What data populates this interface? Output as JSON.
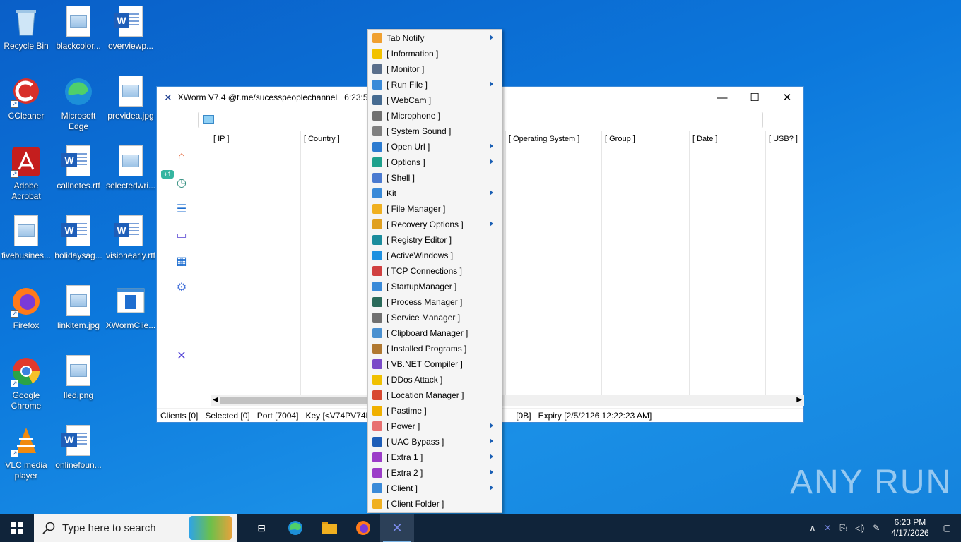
{
  "desktop": {
    "icons": [
      {
        "label": "Recycle Bin"
      },
      {
        "label": "blackcolor..."
      },
      {
        "label": "overviewp..."
      },
      {
        "label": "CCleaner"
      },
      {
        "label": "Microsoft Edge"
      },
      {
        "label": "previdea.jpg"
      },
      {
        "label": "Adobe Acrobat"
      },
      {
        "label": "callnotes.rtf"
      },
      {
        "label": "selectedwri..."
      },
      {
        "label": "fivebusines..."
      },
      {
        "label": "holidaysag..."
      },
      {
        "label": "visionearly.rtf"
      },
      {
        "label": "Firefox"
      },
      {
        "label": "linkitem.jpg"
      },
      {
        "label": "XWormClie..."
      },
      {
        "label": "Google Chrome"
      },
      {
        "label": "lled.png"
      },
      {
        "label": "VLC media player"
      },
      {
        "label": "onlinefoun..."
      }
    ],
    "watermark": "ANY RUN"
  },
  "xworm": {
    "title": "XWorm V7.4 @t.me/sucesspeoplechannel",
    "time": "6:23:58",
    "badge": "+1",
    "columns": [
      "[ IP ]",
      "[ Country ]",
      "[ Operating System ]",
      "[ Group ]",
      "[ Date ]",
      "[ USB? ]"
    ],
    "status": {
      "clients": "Clients [0]",
      "selected": "Selected [0]",
      "port": "Port [7004]",
      "key": "Key [<V74PV74PV7",
      "size": "[0B]",
      "expiry": "Expiry [2/5/2126 12:22:23 AM]"
    }
  },
  "menu": {
    "items": [
      {
        "label": "Tab Notify",
        "icon": "bell-icon",
        "color": "#f0a030",
        "sub": true
      },
      {
        "label": "[ Information ]",
        "icon": "info-icon",
        "color": "#f2c200",
        "sub": false
      },
      {
        "label": "[ Monitor ]",
        "icon": "monitor-icon",
        "color": "#5a6e8a",
        "sub": false
      },
      {
        "label": "[ Run File ]",
        "icon": "run-file-icon",
        "color": "#3a8ad8",
        "sub": true
      },
      {
        "label": "[ WebCam ]",
        "icon": "webcam-icon",
        "color": "#456a90",
        "sub": false
      },
      {
        "label": "[ Microphone ]",
        "icon": "microphone-icon",
        "color": "#707070",
        "sub": false
      },
      {
        "label": "[ System Sound ]",
        "icon": "speaker-icon",
        "color": "#808080",
        "sub": false
      },
      {
        "label": "[ Open Url ]",
        "icon": "globe-icon",
        "color": "#2c7bd0",
        "sub": true
      },
      {
        "label": "[ Options ]",
        "icon": "options-icon",
        "color": "#1ea08c",
        "sub": true
      },
      {
        "label": "[ Shell ]",
        "icon": "code-icon",
        "color": "#4a7ad0",
        "sub": false
      },
      {
        "label": "Kit",
        "icon": "kit-icon",
        "color": "#3a8ad8",
        "sub": true
      },
      {
        "label": "[ File Manager ]",
        "icon": "folder-icon",
        "color": "#f0b020",
        "sub": false
      },
      {
        "label": "[ Recovery Options ]",
        "icon": "key-icon",
        "color": "#e0a020",
        "sub": true
      },
      {
        "label": "[ Registry Editor ]",
        "icon": "registry-icon",
        "color": "#1a8c9c",
        "sub": false
      },
      {
        "label": "[ ActiveWindows ]",
        "icon": "windows-icon",
        "color": "#1e90e0",
        "sub": false
      },
      {
        "label": "[ TCP Connections ]",
        "icon": "network-icon",
        "color": "#d04040",
        "sub": false
      },
      {
        "label": "[ StartupManager ]",
        "icon": "startup-icon",
        "color": "#3a8ad8",
        "sub": false
      },
      {
        "label": "[ Process Manager ]",
        "icon": "process-icon",
        "color": "#2a6a5a",
        "sub": false
      },
      {
        "label": "[ Service Manager ]",
        "icon": "service-icon",
        "color": "#707070",
        "sub": false
      },
      {
        "label": "[ Clipboard Manager ]",
        "icon": "clipboard-icon",
        "color": "#4a90d0",
        "sub": false
      },
      {
        "label": "[ Installed Programs ]",
        "icon": "programs-icon",
        "color": "#b07830",
        "sub": false
      },
      {
        "label": "[ VB.NET Compiler ]",
        "icon": "vs-icon",
        "color": "#7a4ac8",
        "sub": false
      },
      {
        "label": "[ DDos Attack ]",
        "icon": "lightning-icon",
        "color": "#f0c000",
        "sub": false
      },
      {
        "label": "[ Location Manager ]",
        "icon": "location-icon",
        "color": "#d84830",
        "sub": false
      },
      {
        "label": "[ Pastime ]",
        "icon": "crown-icon",
        "color": "#f0b000",
        "sub": false
      },
      {
        "label": "[ Power ]",
        "icon": "power-icon",
        "color": "#e87070",
        "sub": true
      },
      {
        "label": "[ UAC Bypass ]",
        "icon": "shield-icon",
        "color": "#1e5eb8",
        "sub": true
      },
      {
        "label": "[ Extra 1 ]",
        "icon": "plus-icon",
        "color": "#9c3cc8",
        "sub": true
      },
      {
        "label": "[ Extra 2 ]",
        "icon": "plus-icon",
        "color": "#9c3cc8",
        "sub": true
      },
      {
        "label": "[ Client ]",
        "icon": "client-icon",
        "color": "#3a8ad8",
        "sub": true
      },
      {
        "label": "[ Client Folder ]",
        "icon": "client-folder-icon",
        "color": "#f0b020",
        "sub": false
      }
    ]
  },
  "taskbar": {
    "search_placeholder": "Type here to search",
    "time": "6:23 PM",
    "date": "4/17/2026"
  }
}
